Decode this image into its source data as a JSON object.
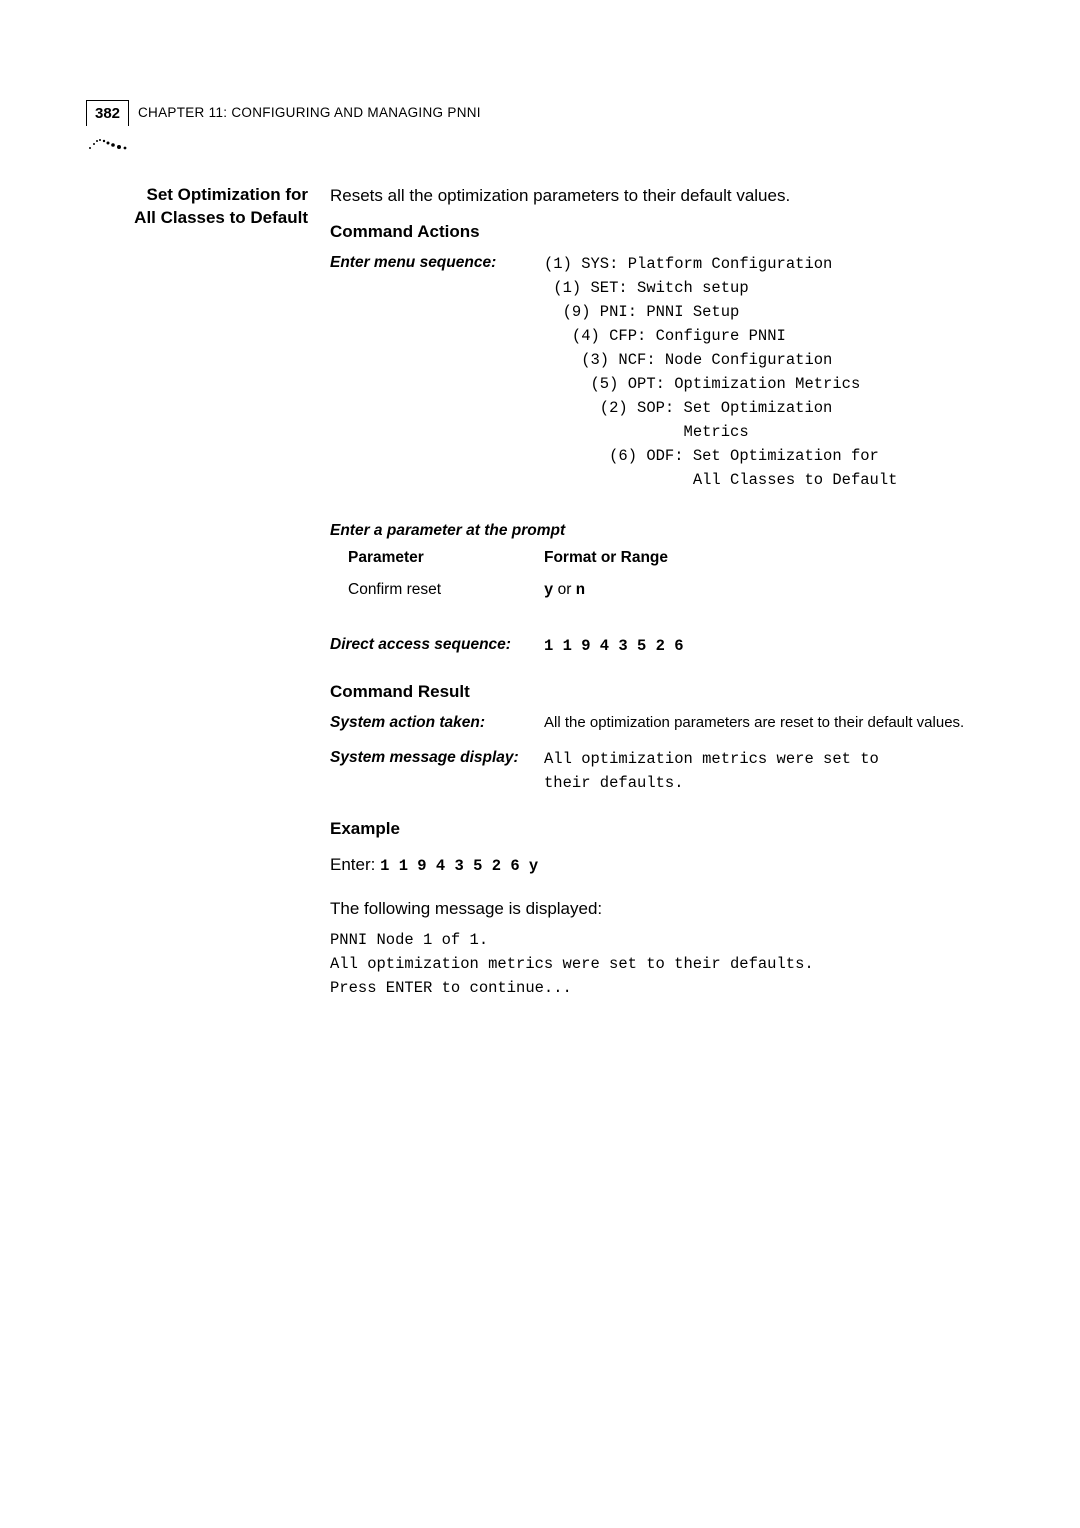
{
  "header": {
    "page_number": "382",
    "chapter_label": "CHAPTER 11: CONFIGURING AND MANAGING PNNI"
  },
  "section": {
    "title_line1": "Set Optimization for",
    "title_line2": "All Classes to Default",
    "intro": "Resets all the optimization parameters to their default values."
  },
  "command_actions": {
    "heading": "Command Actions",
    "menu_label": "Enter menu sequence:",
    "menu_text": "(1) SYS: Platform Configuration\n (1) SET: Switch setup\n  (9) PNI: PNNI Setup\n   (4) CFP: Configure PNNI\n    (3) NCF: Node Configuration\n     (5) OPT: Optimization Metrics\n      (2) SOP: Set Optimization\n               Metrics\n       (6) ODF: Set Optimization for\n                All Classes to Default"
  },
  "parameter_prompt": {
    "heading": "Enter a parameter at the prompt",
    "col1": "Parameter",
    "col2": "Format or Range",
    "row1_param": "Confirm reset",
    "row1_fmt_bold1": "y",
    "row1_fmt_mid": " or ",
    "row1_fmt_bold2": "n"
  },
  "direct_access": {
    "label": "Direct access sequence:",
    "value": "1 1 9 4 3 5 2 6"
  },
  "command_result": {
    "heading": "Command Result",
    "action_label": "System action taken:",
    "action_text": "All the optimization parameters are reset to their default values.",
    "msg_label": "System message display:",
    "msg_text": "All optimization metrics were set to\ntheir defaults."
  },
  "example": {
    "heading": "Example",
    "enter_prefix": "Enter: ",
    "enter_value": "1 1 9 4 3 5 2 6 y",
    "following_msg": "The following message is displayed:",
    "output": "PNNI Node 1 of 1.\nAll optimization metrics were set to their defaults.\nPress ENTER to continue..."
  }
}
